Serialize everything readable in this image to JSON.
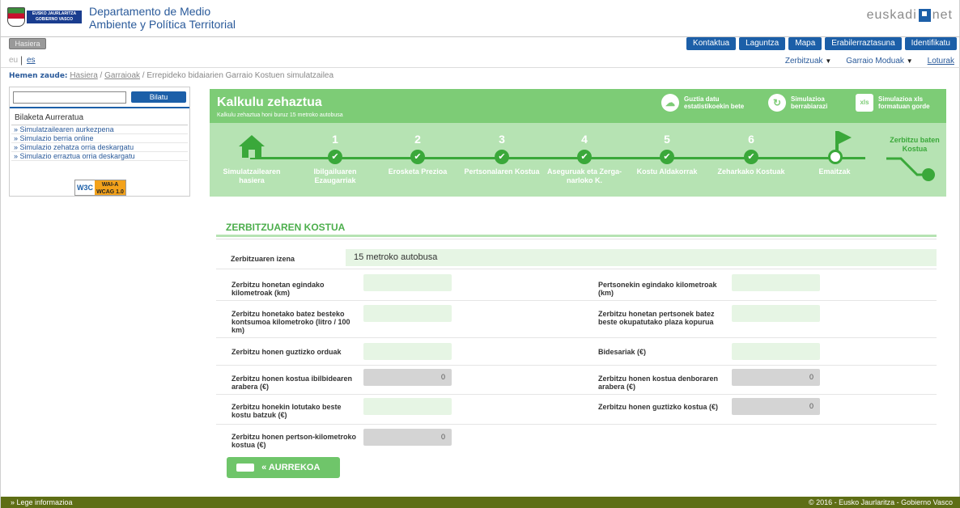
{
  "header": {
    "dept_line1": "Departamento de Medio",
    "dept_line2": "Ambiente y Política Territorial",
    "logo_text1": "EUSKO JAURLARITZA",
    "logo_text2": "GOBIERNO VASCO",
    "euskadi_left": "euskadi",
    "euskadi_right": "net"
  },
  "nav": {
    "home": "Hasiera",
    "links": [
      "Kontaktua",
      "Laguntza",
      "Mapa",
      "Erabilerraztasuna",
      "Identifikatu"
    ],
    "lang_eu": "eu",
    "lang_es": "es",
    "sub_links": [
      "Zerbitzuak",
      "Garraio Moduak",
      "Loturak"
    ]
  },
  "breadcrumb": {
    "label": "Hemen zaude:",
    "items": [
      "Hasiera",
      "Garraioak"
    ],
    "current": "Errepideko bidaiarien Garraio Kostuen simulatzailea"
  },
  "sidebar": {
    "search_button": "Bilatu",
    "advanced": "Bilaketa Aurreratua",
    "items": [
      "» Simulatzailearen aurkezpena",
      "» Simulazio berria online",
      "» Simulazio zehatza orria deskargatu",
      "» Simulazio erraztua orria deskargatu"
    ],
    "badge_w3c": "W3C",
    "badge_wai": "WAI-A",
    "badge_wcag": "WCAG 1.0"
  },
  "panel": {
    "title": "Kalkulu zehaztua",
    "subtitle": "Kalkulu zehaztua honi buruz 15 metroko autobusa",
    "actions": [
      {
        "line1": "Guztia datu",
        "line2": "estatistikoekin bete",
        "icon": "cloud-icon"
      },
      {
        "line1": "Simulazioa",
        "line2": "berrabiarazi",
        "icon": "refresh-icon"
      },
      {
        "line1": "Simulazioa xls",
        "line2": "formatuan gorde",
        "icon": "xls-icon"
      }
    ],
    "steps": [
      {
        "num": "",
        "label": "Simulatzailearen hasiera"
      },
      {
        "num": "1",
        "label": "Ibilgailuaren Ezaugarriak"
      },
      {
        "num": "2",
        "label": "Erosketa Prezioa"
      },
      {
        "num": "3",
        "label": "Pertsonalaren Kostua"
      },
      {
        "num": "4",
        "label": "Aseguruak eta Zerga-narloko K."
      },
      {
        "num": "5",
        "label": "Kostu Aldakorrak"
      },
      {
        "num": "6",
        "label": "Zeharkako Kostuak"
      },
      {
        "num": "",
        "label": "Emaitzak"
      }
    ],
    "end_label": "Zerbitzu baten Kostua"
  },
  "result": {
    "section_title": "ZERBITZUAREN KOSTUA",
    "name_label": "Zerbitzuaren izena",
    "name_value": "15 metroko autobusa",
    "fields_left": [
      {
        "label": "Zerbitzu honetan egindako kilometroak (km)",
        "value": ""
      },
      {
        "label": "Zerbitzu honetako batez besteko kontsumoa kilometroko (litro / 100 km)",
        "value": ""
      },
      {
        "label": "Zerbitzu honen guztizko orduak",
        "value": ""
      },
      {
        "label": "Zerbitzu honen kostua ibilbidearen arabera (€)",
        "value": "0"
      },
      {
        "label": "Zerbitzu honekin lotutako beste kostu batzuk (€)",
        "value": ""
      },
      {
        "label": "Zerbitzu honen pertson-kilometroko kostua (€)",
        "value": "0"
      }
    ],
    "fields_right": [
      {
        "label": "Pertsonekin egindako kilometroak (km)",
        "value": ""
      },
      {
        "label": "Zerbitzu honetan pertsonek batez beste okupatutako plaza kopurua",
        "value": ""
      },
      {
        "label": "Bidesariak (€)",
        "value": ""
      },
      {
        "label": "Zerbitzu honen kostua denboraren arabera (€)",
        "value": "0"
      },
      {
        "label": "Zerbitzu honen guztizko kostua (€)",
        "value": "0"
      }
    ],
    "back_button": "AURREKOA"
  },
  "footer": {
    "left": "» Lege informazioa",
    "right": "© 2016 - Eusko Jaurlaritza - Gobierno Vasco"
  },
  "colors": {
    "accent_blue": "#1c5fa8",
    "green": "#7dcc76",
    "dark_green": "#3aa83a",
    "footer": "#5e6e15"
  }
}
